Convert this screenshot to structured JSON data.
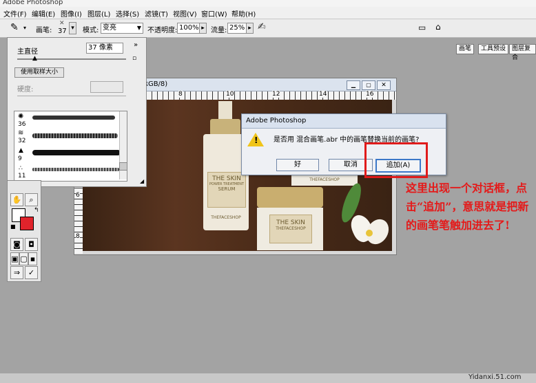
{
  "app": {
    "title": "Adobe Photoshop"
  },
  "menu": [
    "文件(F)",
    "编辑(E)",
    "图像(I)",
    "图层(L)",
    "选择(S)",
    "滤镜(T)",
    "视图(V)",
    "窗口(W)",
    "帮助(H)"
  ],
  "options": {
    "brush_label": "画笔:",
    "brush_size": "37",
    "mode_label": "模式:",
    "mode_value": "变亮",
    "opacity_label": "不透明度:",
    "opacity_value": "100%",
    "flow_label": "流量:",
    "flow_value": "25%",
    "palette_tabs": [
      "画笔",
      "工具预设",
      "图层复合"
    ]
  },
  "brush_panel": {
    "diameter_label": "主直径",
    "diameter_value": "37 像素",
    "use_sample_button": "使用取样大小",
    "hardness_label": "硬度:",
    "presets": [
      {
        "size": "36"
      },
      {
        "size": "32"
      },
      {
        "size": "9"
      },
      {
        "size": "11"
      }
    ]
  },
  "document": {
    "title_fragment": "RGB/8)",
    "ruler_marks": [
      "8",
      "10",
      "12",
      "14",
      "16"
    ],
    "side_marks": [
      "6",
      "8"
    ],
    "products": {
      "brand": "THE SKIN",
      "line1": "POWER TREATMENT",
      "line2": "SERUM",
      "shop": "THEFACESHOP"
    }
  },
  "dialog": {
    "title": "Adobe Photoshop",
    "message": "是否用 混合画笔.abr 中的画笔替换当前的画笔?",
    "ok": "好",
    "cancel": "取消",
    "append": "追加(A)"
  },
  "annotation": "这里出现一个对话框，点击“追加”，意思就是把新的画笔笔触加进去了!",
  "watermark": "Yidanxi.51.com",
  "colors": {
    "annotation": "#e41a1a",
    "foreground": "#ffffff",
    "background": "#e0232b"
  }
}
